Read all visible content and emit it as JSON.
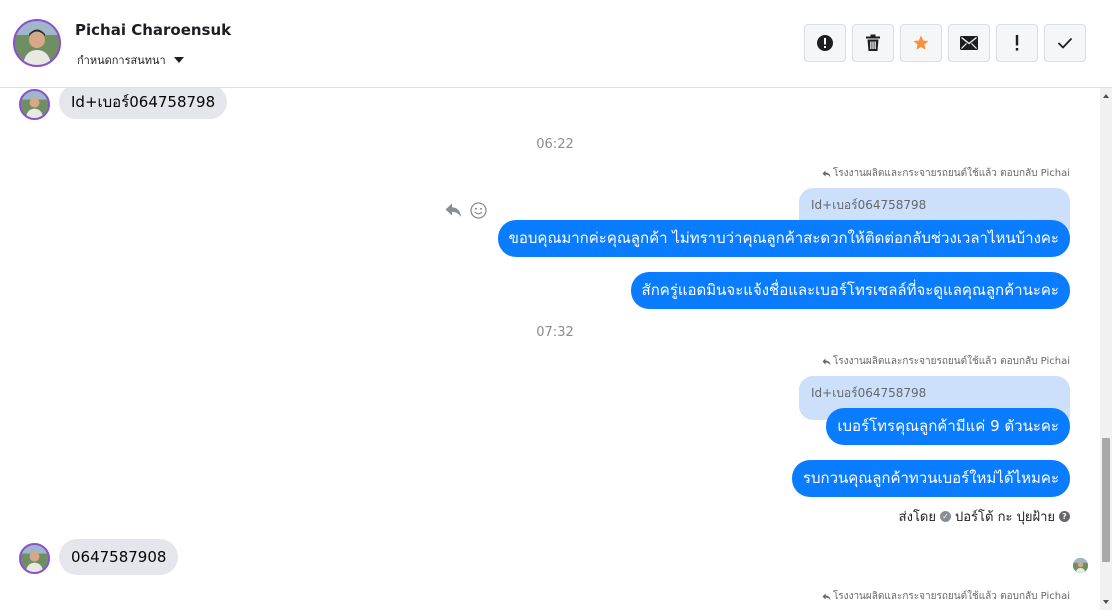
{
  "header": {
    "contact_name": "Pichai Charoensuk",
    "assign_label": "กำหนดการสนทนา",
    "toolbar": [
      {
        "name": "mark-spam-button",
        "icon": "alert-circle-icon"
      },
      {
        "name": "delete-button",
        "icon": "trash-icon"
      },
      {
        "name": "star-button",
        "icon": "star-icon"
      },
      {
        "name": "mark-unread-button",
        "icon": "envelope-icon"
      },
      {
        "name": "follow-up-button",
        "icon": "exclamation-icon"
      },
      {
        "name": "mark-done-button",
        "icon": "checkmark-icon"
      }
    ]
  },
  "colors": {
    "accent": "#0a7cff",
    "star": "#f7923a",
    "quoted_bg": "#cce0fb",
    "incoming_bg": "#e4e6eb"
  },
  "conversation": {
    "incoming_1": "Id+เบอร์064758798",
    "time_1": "06:22",
    "reply_note_1": "โรงงานผลิตและกระจายรถยนต์ใช้แล้ว ตอบกลับ Pichai",
    "quoted_1": "Id+เบอร์064758798",
    "outgoing_1": "ขอบคุณมากค่ะคุณลูกค้า ไม่ทราบว่าคุณลูกค้าสะดวกให้ติดต่อกลับช่วงเวลาไหนบ้างคะ",
    "outgoing_2": "สักครู่แอดมินจะแจ้งชื่อและเบอร์โทรเซลล์ที่จะดูแลคุณลูกค้านะคะ",
    "time_2": "07:32",
    "reply_note_2": "โรงงานผลิตและกระจายรถยนต์ใช้แล้ว ตอบกลับ Pichai",
    "quoted_2": "Id+เบอร์064758798",
    "outgoing_3": "เบอร์โทรคุณลูกค้ามีแค่ 9 ตัวนะคะ",
    "outgoing_4": "รบกวนคุณลูกค้าทวนเบอร์ใหม่ได้ไหมคะ",
    "sent_by_prefix": "ส่งโดย",
    "sent_by_name": "ปอร์โต้ กะ ปุยฝ้าย",
    "incoming_2": "0647587908",
    "reply_note_3": "โรงงานผลิตและกระจายรถยนต์ใช้แล้ว ตอบกลับ Pichai"
  }
}
